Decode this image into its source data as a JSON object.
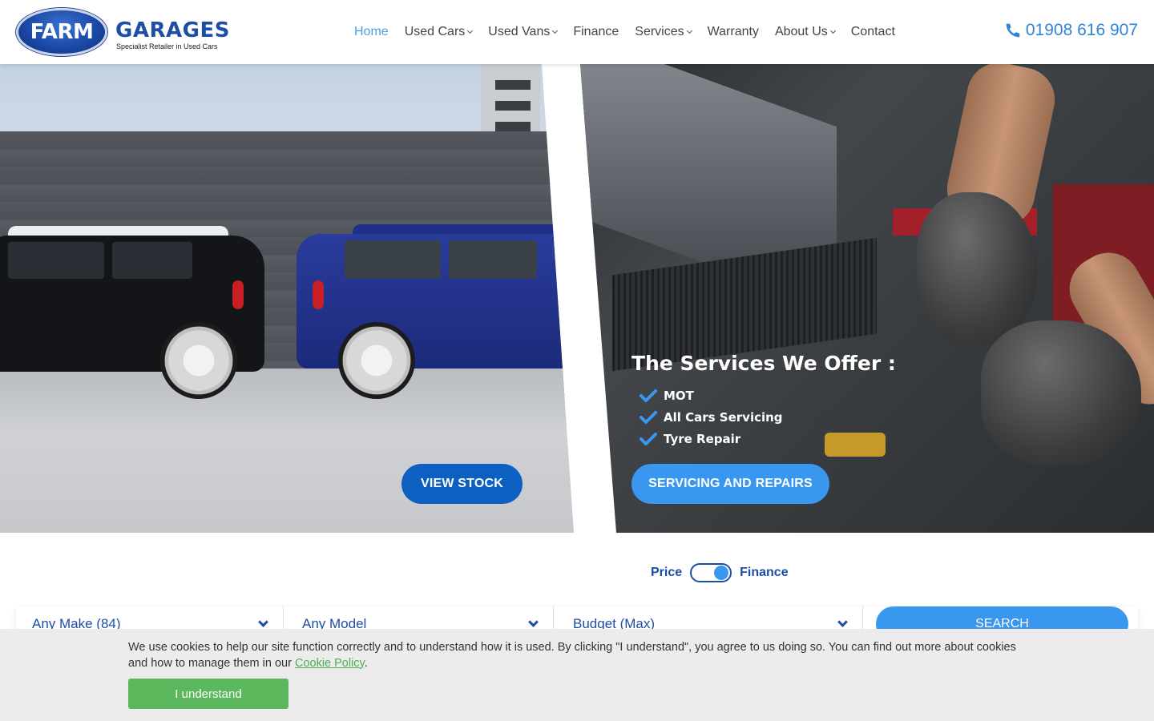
{
  "header": {
    "logo_badge": "FARM",
    "logo_word": "GARAGES",
    "logo_tagline": "Specialist Retailer in Used Cars",
    "nav": [
      {
        "label": "Home",
        "active": true
      },
      {
        "label": "Used Cars",
        "has_dropdown": true
      },
      {
        "label": "Used Vans",
        "has_dropdown": true
      },
      {
        "label": "Finance"
      },
      {
        "label": "Services",
        "has_dropdown": true
      },
      {
        "label": "Warranty"
      },
      {
        "label": "About Us",
        "has_dropdown": true
      },
      {
        "label": "Contact"
      }
    ],
    "phone": "01908 616 907"
  },
  "hero": {
    "view_stock_label": "VIEW STOCK",
    "services_title": "The Services We Offer :",
    "services": [
      "MOT",
      "All Cars Servicing",
      "Tyre Repair"
    ],
    "services_button_label": "SERVICING AND REPAIRS"
  },
  "search": {
    "toggle_left": "Price",
    "toggle_right": "Finance",
    "toggle_state": "Finance",
    "make": "Any Make (84)",
    "model": "Any Model",
    "budget": "Budget (Max)",
    "search_label": "SEARCH"
  },
  "cookie": {
    "text_before": "We use cookies to help our site function correctly and to understand how it is used. By clicking \"I understand\", you agree to us doing so. You can find out more about cookies and how to manage them in our ",
    "link_label": "Cookie Policy",
    "text_after": ".",
    "button_label": "I understand"
  },
  "colors": {
    "brand_blue": "#1d4ea6",
    "accent_blue": "#3a97f0",
    "dark_blue_button": "#0d5fc2",
    "nav_active": "#4a9fe0",
    "cookie_green": "#5cb85c"
  },
  "icons": {
    "phone": "phone-icon",
    "check": "check-icon",
    "dropdown": "chevron-down-icon"
  }
}
